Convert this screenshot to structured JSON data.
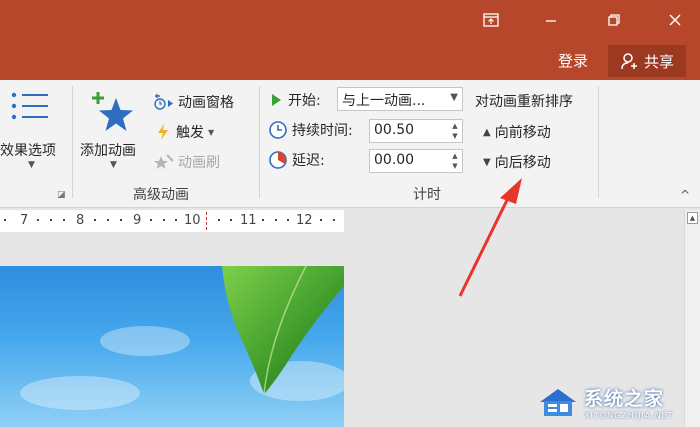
{
  "window": {
    "restore_ribbon_icon": "ribbon-display-icon",
    "minimize_icon": "minimize-icon",
    "maximize_icon": "restore-icon",
    "close_icon": "close-icon"
  },
  "account": {
    "login_label": "登录",
    "share_label": "共享"
  },
  "ribbon": {
    "effect_options_label": "效果选项",
    "advanced_animation": {
      "group_label": "高级动画",
      "add_animation_label": "添加动画",
      "animation_pane_label": "动画窗格",
      "trigger_label": "触发",
      "animation_painter_label": "动画刷"
    },
    "timing": {
      "group_label": "计时",
      "start_label": "开始:",
      "start_value": "与上一动画...",
      "duration_label": "持续时间:",
      "duration_value": "00.50",
      "delay_label": "延迟:",
      "delay_value": "00.00"
    },
    "reorder": {
      "title": "对动画重新排序",
      "move_earlier_label": "向前移动",
      "move_later_label": "向后移动"
    }
  },
  "ruler": {
    "labels": [
      "7",
      "8",
      "9",
      "10",
      "11",
      "12"
    ]
  },
  "watermark": {
    "title": "系统之家",
    "subtitle": "XITONGZHIJIA.NET"
  },
  "colors": {
    "title_bar": "#b7472a",
    "annotation_arrow": "#e8352b"
  }
}
